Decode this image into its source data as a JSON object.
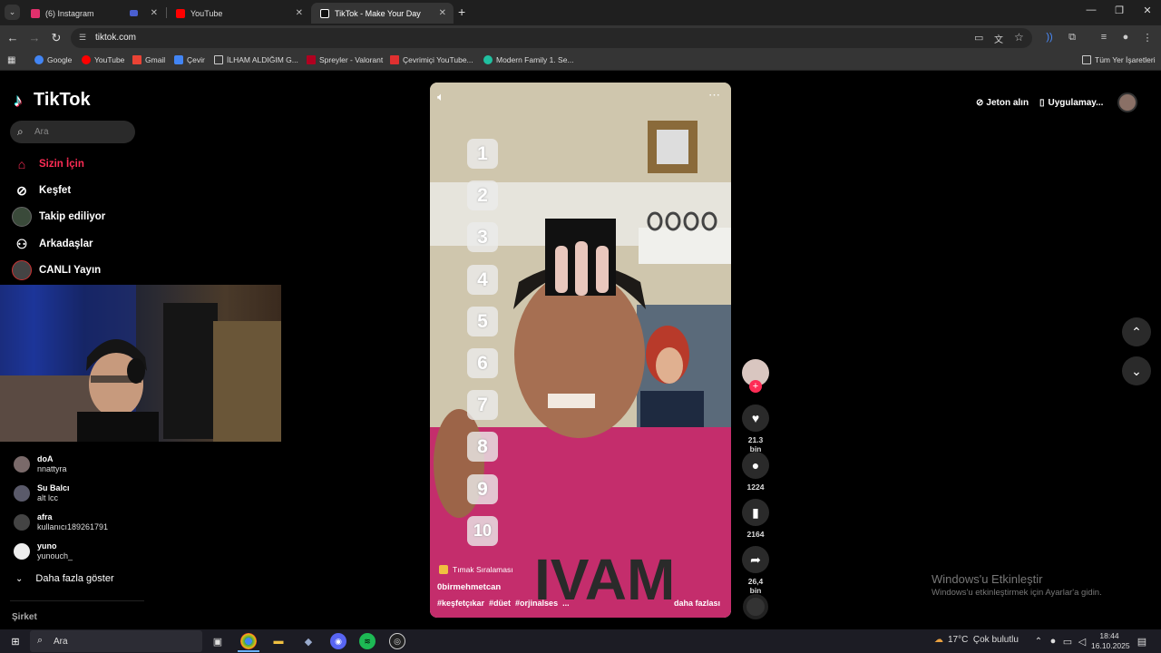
{
  "browser": {
    "tabs": [
      {
        "label": "(6) Instagram",
        "color": "#e1306c"
      },
      {
        "label": "YouTube",
        "color": "#ff0000"
      },
      {
        "label": "TikTok - Make Your Day",
        "color": "#ffffff"
      }
    ],
    "url": "tiktok.com",
    "bookmarks": [
      {
        "label": "Google",
        "color": "#4285f4"
      },
      {
        "label": "YouTube",
        "color": "#ff0000"
      },
      {
        "label": "Gmail",
        "color": "#ea4335"
      },
      {
        "label": "Çevir",
        "color": "#4285f4"
      },
      {
        "label": "İLHAM ALDIĞIM G...",
        "color": "#cccccc"
      },
      {
        "label": "Spreyler - Valorant",
        "color": "#b00020"
      },
      {
        "label": "Çevrimiçi YouTube...",
        "color": "#e03030"
      },
      {
        "label": "Modern Family 1. Se...",
        "color": "#20c0a0"
      }
    ],
    "all_bookmarks": "Tüm Yer İşaretleri"
  },
  "tiktok": {
    "logo": "TikTok",
    "search_placeholder": "Ara",
    "nav": [
      {
        "label": "Sizin İçin",
        "icon": "home-icon"
      },
      {
        "label": "Keşfet",
        "icon": "compass-icon"
      },
      {
        "label": "Takip ediliyor",
        "icon": "following-icon"
      },
      {
        "label": "Arkadaşlar",
        "icon": "friends-icon"
      },
      {
        "label": "CANLI Yayın",
        "icon": "live-icon"
      }
    ],
    "following": [
      {
        "name": "doA",
        "user": "nnattyra"
      },
      {
        "name": "Su Balcı",
        "user": "alt lcc"
      },
      {
        "name": "afra",
        "user": "kullanıcı189261791"
      },
      {
        "name": "yuno",
        "user": "yunouch_"
      }
    ],
    "show_more": "Daha fazla göster",
    "company": "Şirket",
    "header": {
      "coins": "Jeton alın",
      "app": "Uygulamay..."
    },
    "video": {
      "numbers": [
        "1",
        "2",
        "3",
        "4",
        "5",
        "6",
        "7",
        "8",
        "9",
        "10"
      ],
      "tag": "Tımak Sıralaması",
      "author": "0birmehmetcan",
      "hashtags": "#keşfetçıkar  #düet  #orjinalses  ...",
      "more": "daha fazlası",
      "shirt_text": "IVAM"
    },
    "actions": {
      "likes": "21.3 bin",
      "comments": "1224",
      "saves": "2164",
      "shares": "26,4 bin"
    }
  },
  "windows": {
    "activate_title": "Windows'u Etkinleştir",
    "activate_sub": "Windows'u etkinleştirmek için Ayarlar'a gidin.",
    "search": "Ara",
    "weather": "17°C  Çok bulutlu",
    "time": "18:44",
    "date": "16.10.2025"
  }
}
